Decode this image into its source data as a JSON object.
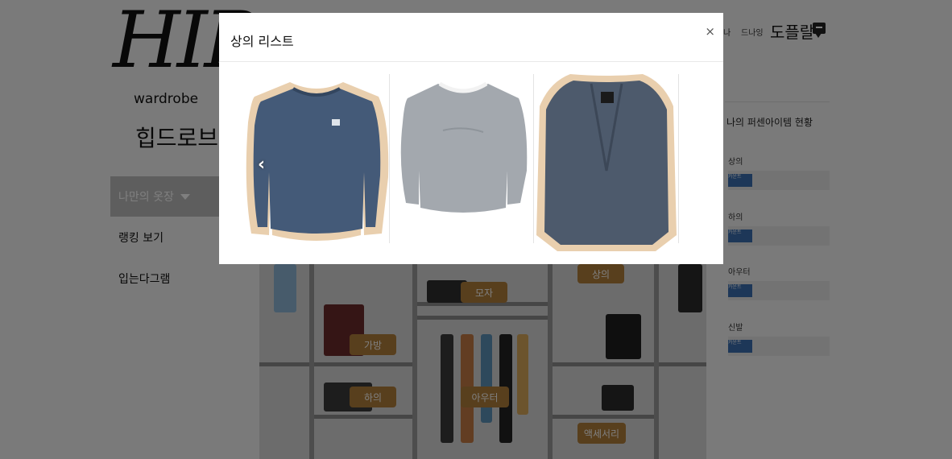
{
  "sidebar": {
    "logo_text": "HIP",
    "logo_subtitle": "wardrobe",
    "logo_korean": "힙드로브",
    "menu": [
      {
        "label": "나만의 옷장"
      },
      {
        "label": "랭킹 보기"
      },
      {
        "label": "입는다그램"
      }
    ]
  },
  "header": {
    "links": [
      "나",
      "드나잉"
    ],
    "username": "도플랄",
    "chat_icon": "chat-bubble-icon"
  },
  "right_panel": {
    "title": "나의 퍼센아이템 현황",
    "categories": [
      {
        "label": "상의",
        "fill": 0.24,
        "fill_text": "카운트"
      },
      {
        "label": "하의",
        "fill": 0.24,
        "fill_text": "카운트"
      },
      {
        "label": "아우터",
        "fill": 0.24,
        "fill_text": "카운트"
      },
      {
        "label": "신발",
        "fill": 0.24,
        "fill_text": "카운트"
      }
    ]
  },
  "closet": {
    "tags": [
      "모자",
      "가방",
      "하의",
      "아우터",
      "상의",
      "액세서리"
    ]
  },
  "modal": {
    "title": "상의 리스트",
    "close_label": "×",
    "prev_arrow": "‹",
    "items": [
      {
        "name": "navy-sweatshirt",
        "color": "#445a78"
      },
      {
        "name": "gray-sweatshirt",
        "color": "#a3a8ae"
      },
      {
        "name": "navy-cardigan",
        "color": "#4d5a6c"
      }
    ]
  },
  "colors": {
    "accent_tag": "#b17e3a",
    "status_fill": "#3b6fb0",
    "overlay": "rgba(0,0,0,0.5)"
  }
}
